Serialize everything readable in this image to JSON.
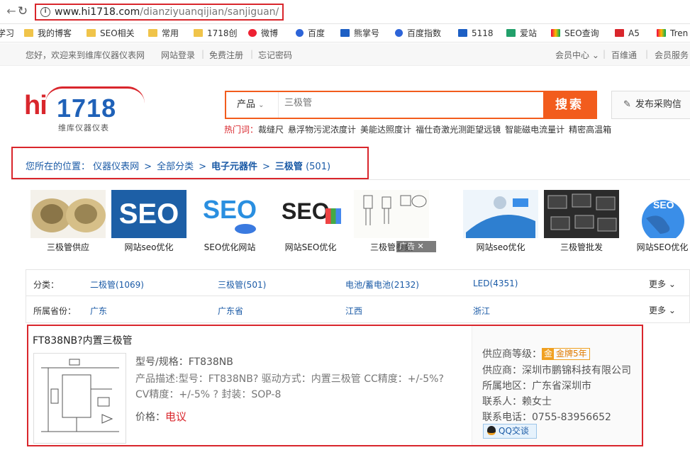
{
  "browser": {
    "url_host": "www.hi1718.com",
    "url_path": "/dianziyuanqijian/sanjiguan/"
  },
  "bookmarks": [
    {
      "label": "学习",
      "icon": "folder-icon"
    },
    {
      "label": "我的博客",
      "icon": "folder-icon"
    },
    {
      "label": "SEO相关",
      "icon": "folder-icon"
    },
    {
      "label": "常用",
      "icon": "folder-icon"
    },
    {
      "label": "1718创",
      "icon": "folder-icon"
    },
    {
      "label": "微博",
      "icon": "weibo-icon"
    },
    {
      "label": "百度",
      "icon": "baidu-paw-icon"
    },
    {
      "label": "熊掌号",
      "icon": "bear-paw-icon"
    },
    {
      "label": "百度指数",
      "icon": "baidu-paw-icon"
    },
    {
      "label": "5118",
      "icon": "5118-icon"
    },
    {
      "label": "爱站",
      "icon": "aizhan-icon"
    },
    {
      "label": "SEO查询",
      "icon": "chinaz-icon"
    },
    {
      "label": "A5",
      "icon": "a5-icon"
    },
    {
      "label": "Tren",
      "icon": "google-icon"
    }
  ],
  "topbar": {
    "welcome": "您好，欢迎来到维库仪器仪表网",
    "login": "网站登录",
    "register": "免费注册",
    "forgot": "忘记密码",
    "member_center": "会员中心",
    "baiweitong": "百维通",
    "member_service": "会员服务"
  },
  "logo": {
    "hi": "hi",
    "num": "1718",
    "subtitle": "维库仪器仪表"
  },
  "search": {
    "category": "产品",
    "placeholder": "三极管",
    "button": "搜索",
    "publish": "发布采购信",
    "hot_label": "热门词：",
    "hot_words": [
      "裁缝尺",
      "悬浮物污泥浓度计",
      "美能达照度计",
      "福仕奇激光测距望远镜",
      "智能磁电流量计",
      "精密高温箱"
    ]
  },
  "breadcrumb": {
    "prefix": "您所在的位置：",
    "items": [
      "仪器仪表网",
      "全部分类",
      "电子元器件",
      "三极管"
    ],
    "count": "(501)"
  },
  "ads": [
    {
      "caption": "三极管供应"
    },
    {
      "caption": "网站seo优化"
    },
    {
      "caption": "SEO优化网站"
    },
    {
      "caption": "网站SEO优化"
    },
    {
      "caption": "三极管参数"
    },
    {
      "caption": "网站seo优化"
    },
    {
      "caption": "三极管批发"
    },
    {
      "caption": "网站SEO优化"
    }
  ],
  "ad_close": "广告",
  "filters": {
    "category_label": "分类：",
    "categories": [
      "二极管(1069)",
      "三极管(501)",
      "电池/蓄电池(2132)",
      "LED(4351)"
    ],
    "province_label": "所属省份：",
    "provinces": [
      "广东",
      "广东省",
      "江西",
      "浙江"
    ],
    "more": "更多"
  },
  "product": {
    "title": "FT838NB?内置三极管",
    "spec": "型号/规格：FT838NB",
    "desc_line1": "产品描述:型号：FT838NB? 驱动方式：内置三极管 CC精度：+/-5%?",
    "desc_line2": "CV精度：+/-5% ? 封装：SOP-8",
    "price_label": "价格：",
    "price": "电议",
    "supplier_level_label": "供应商等级：",
    "badge_gold": "金",
    "badge_text": "金牌5年",
    "supplier": "供应商：深圳市鹏锦科技有限公司",
    "region": "所属地区：广东省深圳市",
    "contact": "联系人：赖女士",
    "phone": "联系电话：0755-83956652",
    "qq": "QQ交谈"
  }
}
